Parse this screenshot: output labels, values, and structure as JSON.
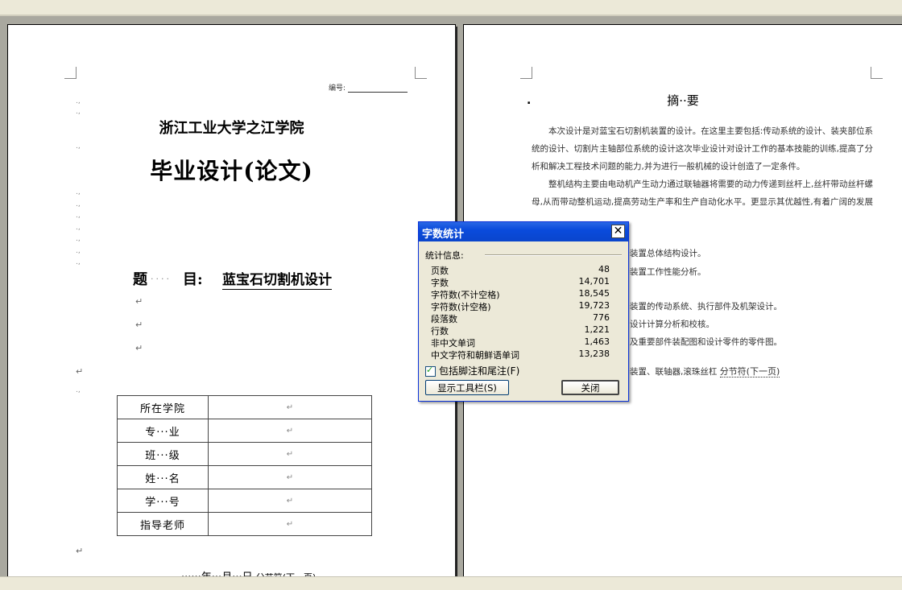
{
  "left_page": {
    "code_label": "编号:",
    "school": "浙江工业大学之江学院",
    "thesis_title": "毕业设计(论文)",
    "topic_label_1": "题",
    "topic_label_2": "目:",
    "topic_value": "蓝宝石切割机设计",
    "info_table": [
      {
        "key": "所在学院",
        "value": "↵"
      },
      {
        "key": "专···业",
        "value": "↵"
      },
      {
        "key": "班···级",
        "value": "↵"
      },
      {
        "key": "姓···名",
        "value": "↵"
      },
      {
        "key": "学···号",
        "value": "↵"
      },
      {
        "key": "指导老师",
        "value": "↵"
      }
    ],
    "date_line": "······年···月···日",
    "section_break": "分节符(下一页)"
  },
  "right_page": {
    "abstract_title": "摘··要",
    "paragraph_1": "本次设计是对蓝宝石切割机装置的设计。在这里主要包括:传动系统的设计、装夹部位系统的设计、切割片主轴部位系统的设计这次毕业设计对设计工作的基本技能的训练,提高了分析和解决工程技术问题的能力,并为进行一般机械的设计创造了一定条件。",
    "paragraph_2": "整机结构主要由电动机产生动力通过联轴器将需要的动力传递到丝杆上,丝杆带动丝杆螺母,从而带动整机运动,提高劳动生产率和生产自动化水平。更显示其优越性,有着广阔的发展前途。",
    "line_3": "装置总体结构设计。",
    "line_4": "装置工作性能分析。",
    "line_5": "装置的传动系统、执行部件及机架设计。",
    "line_6": "设计计算分析和校核。",
    "line_7": "及重要部件装配图和设计零件的零件图。",
    "line_8": "装置、联轴器,滚珠丝杠",
    "section_break": "分节符(下一页)"
  },
  "dialog": {
    "title": "字数统计",
    "close_icon": "✕",
    "group_label": "统计信息:",
    "stats": [
      {
        "label": "页数",
        "value": "48"
      },
      {
        "label": "字数",
        "value": "14,701"
      },
      {
        "label": "字符数(不计空格)",
        "value": "18,545"
      },
      {
        "label": "字符数(计空格)",
        "value": "19,723"
      },
      {
        "label": "段落数",
        "value": "776"
      },
      {
        "label": "行数",
        "value": "1,221"
      },
      {
        "label": "非中文单词",
        "value": "1,463"
      },
      {
        "label": "中文字符和朝鲜语单词",
        "value": "13,238"
      }
    ],
    "checkbox_label": "包括脚注和尾注(F)",
    "checkbox_checked": true,
    "toolbar_button": "显示工具栏(S)",
    "close_button": "关闭"
  }
}
